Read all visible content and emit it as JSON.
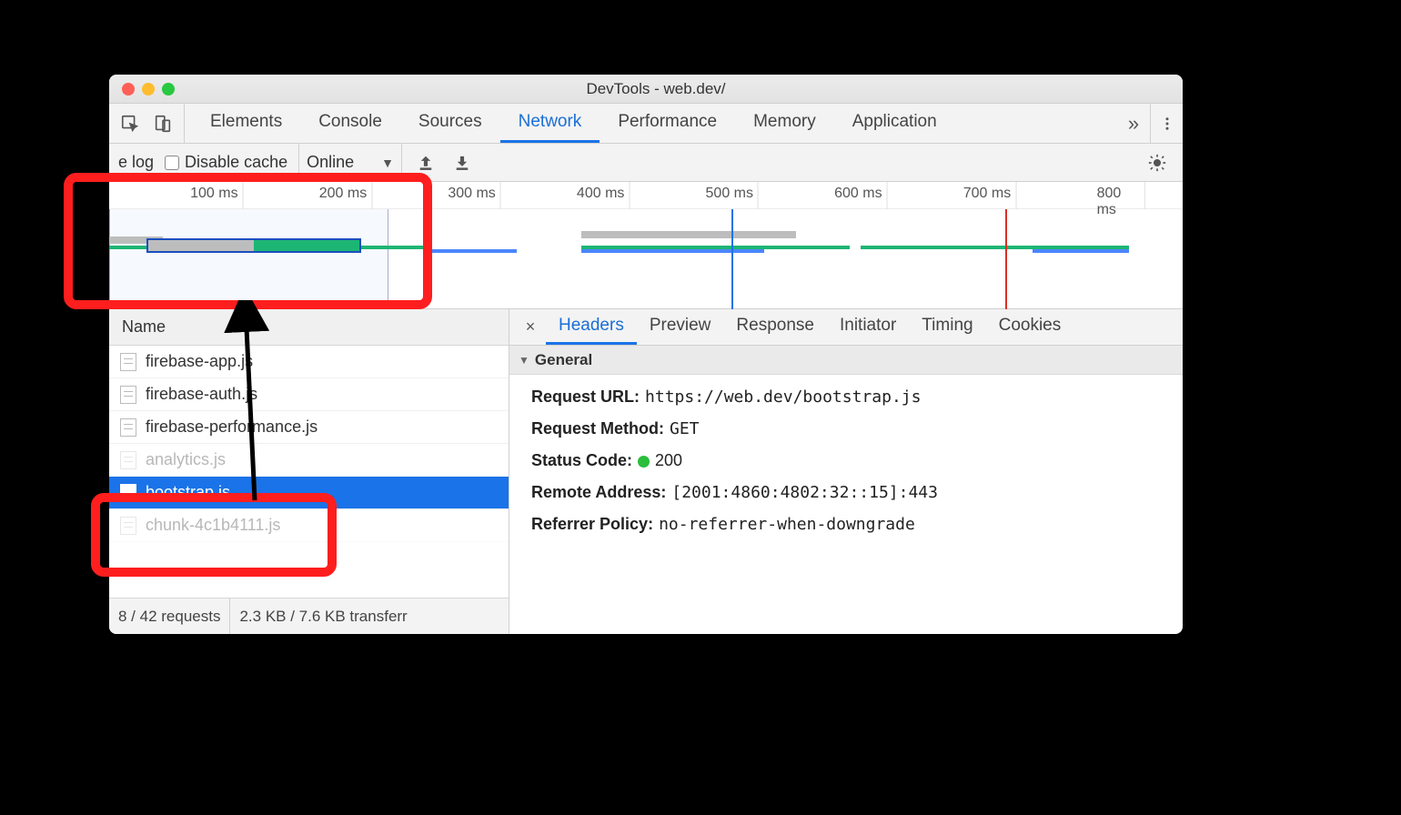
{
  "window_title": "DevTools - web.dev/",
  "tabs": [
    "Elements",
    "Console",
    "Sources",
    "Network",
    "Performance",
    "Memory",
    "Application"
  ],
  "active_tab": "Network",
  "toolbar": {
    "preserve_log": "e log",
    "disable_cache": "Disable cache",
    "online": "Online"
  },
  "timeline_ticks": [
    "100 ms",
    "200 ms",
    "300 ms",
    "400 ms",
    "500 ms",
    "600 ms",
    "700 ms",
    "800 ms"
  ],
  "request_header": "Name",
  "requests": [
    {
      "name": "firebase-app.js",
      "selected": false,
      "partial": false
    },
    {
      "name": "firebase-auth.js",
      "selected": false,
      "partial": false
    },
    {
      "name": "firebase-performance.js",
      "selected": false,
      "partial": false
    },
    {
      "name": "analytics.js",
      "selected": false,
      "partial": true
    },
    {
      "name": "bootstrap.js",
      "selected": true,
      "partial": false
    },
    {
      "name": "chunk-4c1b4111.js",
      "selected": false,
      "partial": true
    }
  ],
  "status": {
    "requests": "8 / 42 requests",
    "transfer": "2.3 KB / 7.6 KB transferr"
  },
  "detail_tabs": [
    "Headers",
    "Preview",
    "Response",
    "Initiator",
    "Timing",
    "Cookies"
  ],
  "active_detail": "Headers",
  "section_title": "General",
  "general": {
    "request_url_label": "Request URL:",
    "request_url": "https://web.dev/bootstrap.js",
    "method_label": "Request Method:",
    "method": "GET",
    "status_label": "Status Code:",
    "status": "200",
    "remote_label": "Remote Address:",
    "remote": "[2001:4860:4802:32::15]:443",
    "referrer_label": "Referrer Policy:",
    "referrer": "no-referrer-when-downgrade"
  }
}
